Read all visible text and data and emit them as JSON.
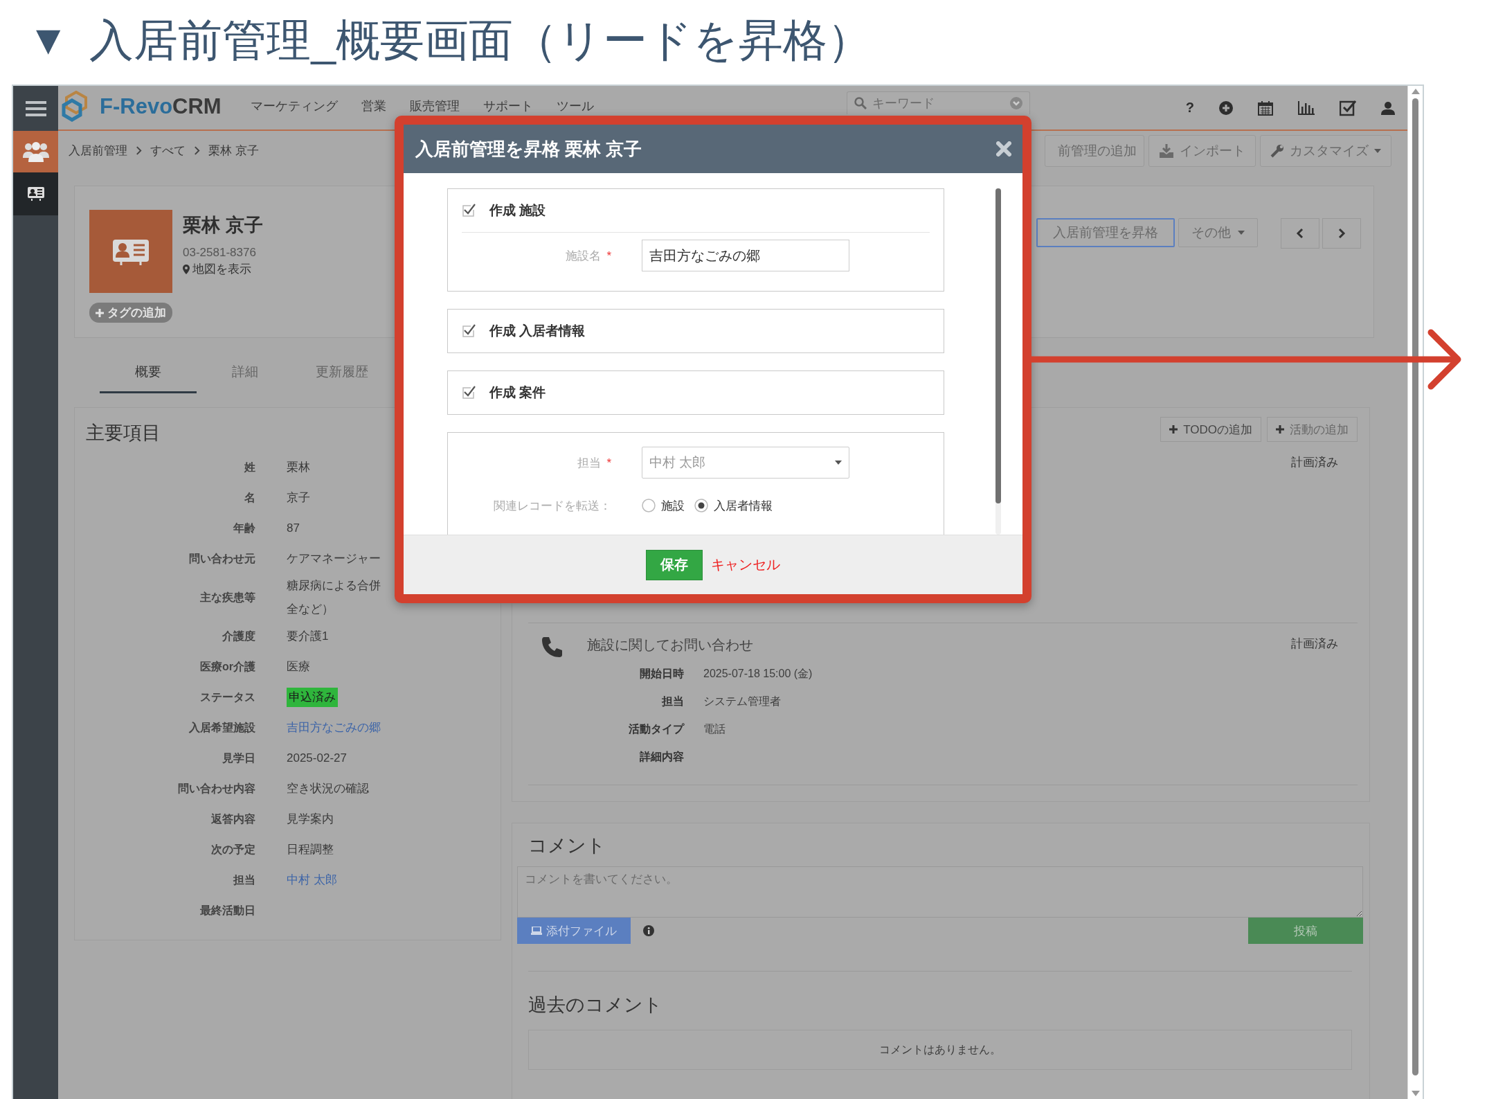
{
  "heading": {
    "marker": "▼",
    "title": "入居前管理_概要画面（リードを昇格）"
  },
  "topbar": {
    "logo": {
      "part1": "F-Revo",
      "part2": "CRM"
    },
    "menu": [
      "マーケティング",
      "営業",
      "販売管理",
      "サポート",
      "ツール"
    ],
    "search": {
      "placeholder": "キーワード"
    },
    "help": "?"
  },
  "breadcrumb": [
    "入居前管理",
    "すべて",
    "栗林 京子"
  ],
  "header_buttons": [
    {
      "label": "前管理の追加",
      "kind": "add"
    },
    {
      "label": "インポート",
      "kind": "import"
    },
    {
      "label": "カスタマイズ",
      "kind": "customize"
    }
  ],
  "record": {
    "name": "栗林 京子",
    "phone": "03-2581-8376",
    "map_link": "地図を表示",
    "tag_button": "タグの追加",
    "actions": [
      {
        "label": "入居前管理を昇格",
        "kind": "button"
      },
      {
        "label": "その他",
        "kind": "dropdown"
      }
    ]
  },
  "tabs": [
    {
      "label": "概要",
      "selected": true
    },
    {
      "label": "詳細",
      "selected": false
    },
    {
      "label": "更新履歴",
      "selected": false
    }
  ],
  "key_fields": {
    "title": "主要項目",
    "rows": [
      {
        "label": "姓",
        "kind": "text",
        "lines": [
          "栗林"
        ]
      },
      {
        "label": "名",
        "kind": "text",
        "lines": [
          "京子"
        ]
      },
      {
        "label": "年齢",
        "kind": "text",
        "lines": [
          "87"
        ]
      },
      {
        "label": "問い合わせ元",
        "kind": "text",
        "lines": [
          "ケアマネージャー"
        ]
      },
      {
        "label": "主な疾患等",
        "kind": "text",
        "lines": [
          "糖尿病による合併",
          "全など）"
        ]
      },
      {
        "label": "介護度",
        "kind": "text",
        "lines": [
          "要介護1"
        ]
      },
      {
        "label": "医療or介護",
        "kind": "text",
        "lines": [
          "医療"
        ]
      },
      {
        "label": "ステータス",
        "kind": "badge",
        "lines": [
          "申込済み"
        ]
      },
      {
        "label": "入居希望施設",
        "kind": "link",
        "lines": [
          "吉田方なごみの郷"
        ]
      },
      {
        "label": "見学日",
        "kind": "text",
        "lines": [
          "2025-02-27"
        ]
      },
      {
        "label": "問い合わせ内容",
        "kind": "text",
        "lines": [
          "空き状況の確認"
        ]
      },
      {
        "label": "返答内容",
        "kind": "text",
        "lines": [
          "見学案内"
        ]
      },
      {
        "label": "次の予定",
        "kind": "text",
        "lines": [
          "日程調整"
        ]
      },
      {
        "label": "担当",
        "kind": "link",
        "lines": [
          "中村 太郎"
        ]
      },
      {
        "label": "最終活動日",
        "lines": []
      }
    ]
  },
  "activities": {
    "buttons": [
      "TODOの追加",
      "活動の追加"
    ],
    "items": [
      {
        "status": "計画済み"
      },
      {
        "title": "施設に関してお問い合わせ",
        "status": "計画済み",
        "details": [
          {
            "label": "開始日時",
            "value": "2025-07-18 15:00 (金)"
          },
          {
            "label": "担当",
            "value": "システム管理者"
          },
          {
            "label": "活動タイプ",
            "value": "電話"
          },
          {
            "label": "詳細内容"
          }
        ]
      }
    ]
  },
  "comments": {
    "title": "コメント",
    "placeholder": "コメントを書いてください。",
    "attach_button": "添付ファイル",
    "post_button": "投稿",
    "past_title": "過去のコメント",
    "empty_message": "コメントはありません。"
  },
  "modal": {
    "title": "入居前管理を昇格 栗林 京子",
    "sections": [
      {
        "label": "作成 施設",
        "checked": true,
        "fields": [
          {
            "label": "施設名",
            "required_mark": "*",
            "kind": "text",
            "value": "吉田方なごみの郷"
          }
        ]
      },
      {
        "label": "作成 入居者情報",
        "checked": true
      },
      {
        "label": "作成 案件",
        "checked": true
      },
      {
        "fields": [
          {
            "label": "担当",
            "required_mark": "*",
            "kind": "select",
            "value": "中村 太郎"
          },
          {
            "label": "関連レコードを転送：",
            "kind": "radio",
            "options": [
              {
                "label": "施設",
                "selected": false
              },
              {
                "label": "入居者情報",
                "selected": true
              }
            ]
          }
        ]
      }
    ],
    "save_button": "保存",
    "cancel_link": "キャンセル"
  }
}
